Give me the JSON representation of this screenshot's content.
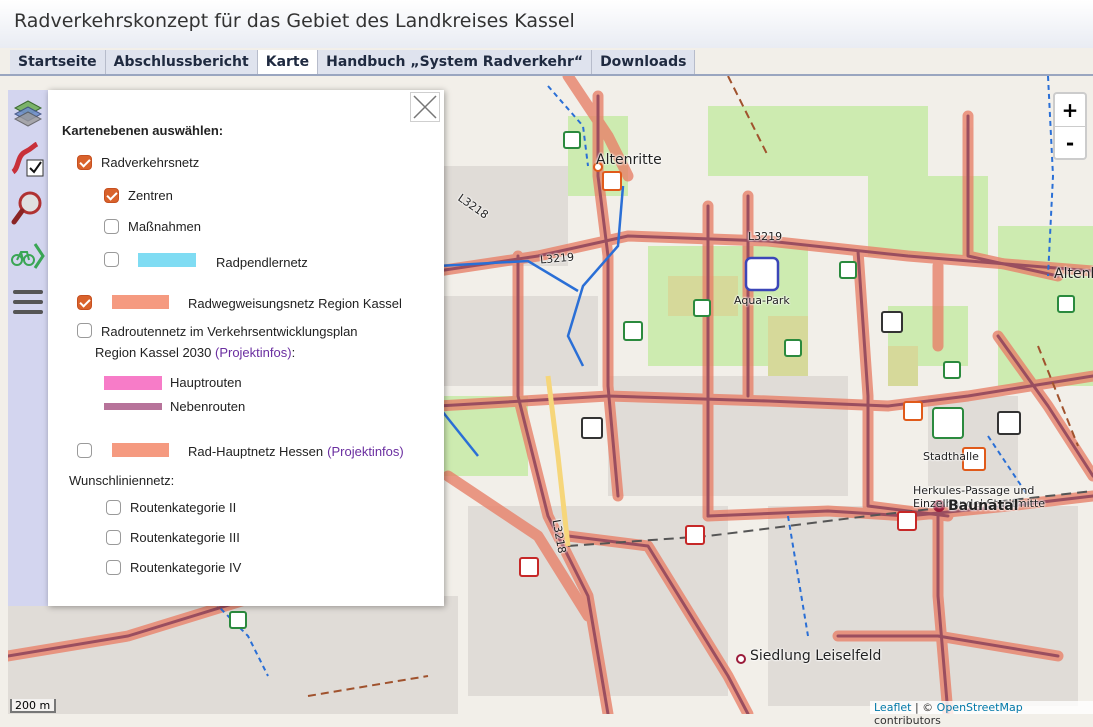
{
  "header": {
    "title": "Radverkehrskonzept für das Gebiet des Landkreises Kassel"
  },
  "tabs": [
    {
      "label": "Startseite",
      "active": false
    },
    {
      "label": "Abschlussbericht",
      "active": false
    },
    {
      "label": "Karte",
      "active": true
    },
    {
      "label": "Handbuch „System Radverkehr“",
      "active": false
    },
    {
      "label": "Downloads",
      "active": false
    }
  ],
  "sidebar": {
    "tools": [
      "layers-icon",
      "route-check-icon",
      "search-icon",
      "bike-icon",
      "menu-icon"
    ]
  },
  "layer_panel": {
    "heading": "Kartenebenen auswählen:",
    "radverkehrsnetz": {
      "label": "Radverkehrsnetz",
      "checked": true
    },
    "zentren": {
      "label": "Zentren",
      "checked": true
    },
    "massnahmen": {
      "label": "Maßnahmen",
      "checked": false
    },
    "radpendlernetz": {
      "label": "Radpendlernetz",
      "checked": false,
      "color": "#7fdcf3"
    },
    "radwegweisungsnetz": {
      "label": "Radwegweisungsnetz Region Kassel",
      "checked": true,
      "color": "#f59a80"
    },
    "radroutennetz": {
      "label_line1": "Radroutennetz im Verkehrsentwicklungsplan",
      "label_line2": "Region Kassel 2030",
      "link": "(Projektinfos)",
      "suffix": ":",
      "checked": false
    },
    "hauptrouten": {
      "label": "Hauptrouten",
      "color": "#f77cc8"
    },
    "nebenrouten": {
      "label": "Nebenrouten",
      "color": "#b7739a"
    },
    "radhauptnetz": {
      "label": "Rad-Hauptnetz Hessen",
      "link": "(Projektinfos)",
      "checked": false,
      "color": "#f59a80"
    },
    "wunschlinien": {
      "label": "Wunschliniennetz:"
    },
    "routenkategorie_2": {
      "label": "Routenkategorie II",
      "checked": false
    },
    "routenkategorie_3": {
      "label": "Routenkategorie III",
      "checked": false
    },
    "routenkategorie_4": {
      "label": "Routenkategorie IV",
      "checked": false
    }
  },
  "zoom": {
    "in": "+",
    "out": "-"
  },
  "map_labels": {
    "altenritte": "Altenritte",
    "altenb": "Altenb",
    "aqua_park": "Aqua-Park",
    "stadthalle": "Stadthalle",
    "herkules_1": "Herkules-Passage und",
    "herkules_2": "Einzelhandel Stadtmitte",
    "baunatal": "Baunatal",
    "siedlung": "Siedlung Leiselfeld",
    "l3218_a": "L3218",
    "l3219_a": "L3219",
    "l3219_b": "L3219",
    "l3218_b": "L3218"
  },
  "scale": "200 m",
  "attribution": {
    "leaflet": "Leaflet",
    "sep": " | © ",
    "osm": "OpenStreetMap",
    "rest": " contributors"
  },
  "colors": {
    "route_outline": "#e8826a",
    "route_core": "#9a4e5f",
    "cycle_path": "#2a6fd6",
    "header_tab": "#dfe3ee",
    "checkbox_on": "#d9622b"
  }
}
